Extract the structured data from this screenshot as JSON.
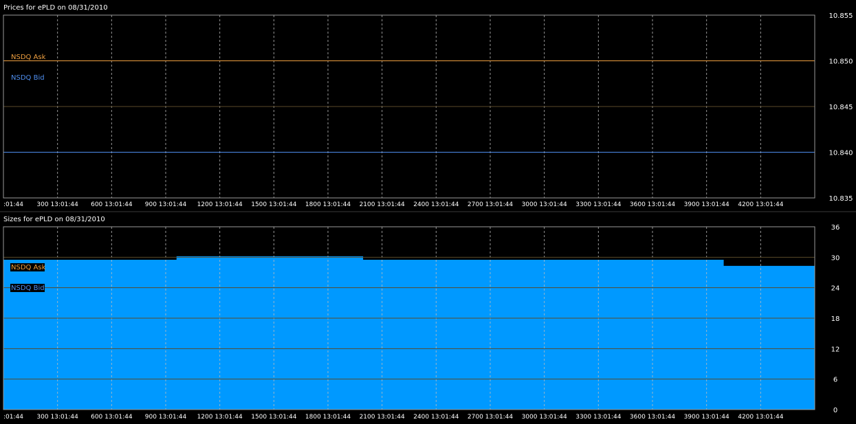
{
  "colors": {
    "background": "#000000",
    "grid": "#bdbdbd",
    "frame": "#9a9a9a",
    "text": "#ffffff",
    "ask": "#f0a040",
    "bid": "#4f8ff0",
    "size_fill": "#0099ff",
    "size_fill_bid": "#33aaff"
  },
  "chart_data": [
    {
      "type": "line",
      "title": "Prices for  ePLD  on  08/31/2010",
      "x_tick_labels": [
        ":01:44",
        "300 13:01:44",
        "600 13:01:44",
        "900 13:01:44",
        "1200 13:01:44",
        "1500 13:01:44",
        "1800 13:01:44",
        "2100 13:01:44",
        "2400 13:01:44",
        "2700 13:01:44",
        "3000 13:01:44",
        "3300 13:01:44",
        "3600 13:01:44",
        "3900 13:01:44",
        "4200 13:01:44"
      ],
      "x_tick_values": [
        0,
        300,
        600,
        900,
        1200,
        1500,
        1800,
        2100,
        2400,
        2700,
        3000,
        3300,
        3600,
        3900,
        4200
      ],
      "xlim": [
        0,
        4500
      ],
      "ylim": [
        10.835,
        10.855
      ],
      "y_tick_values": [
        10.835,
        10.84,
        10.845,
        10.85,
        10.855
      ],
      "y_tick_labels": [
        "10.835",
        "10.840",
        "10.845",
        "10.850",
        "10.855"
      ],
      "grid": true,
      "legend_position": "top-left",
      "series": [
        {
          "name": "NSDQ Ask",
          "color": "#f0a040",
          "x": [
            0,
            4500
          ],
          "y": [
            10.85,
            10.85
          ]
        },
        {
          "name": "NSDQ Bid",
          "color": "#4f8ff0",
          "x": [
            0,
            4500
          ],
          "y": [
            10.84,
            10.84
          ]
        }
      ]
    },
    {
      "type": "area",
      "title": "Sizes for  ePLD  on  08/31/2010",
      "x_tick_labels": [
        ":01:44",
        "300 13:01:44",
        "600 13:01:44",
        "900 13:01:44",
        "1200 13:01:44",
        "1500 13:01:44",
        "1800 13:01:44",
        "2100 13:01:44",
        "2400 13:01:44",
        "2700 13:01:44",
        "3000 13:01:44",
        "3300 13:01:44",
        "3600 13:01:44",
        "3900 13:01:44",
        "4200 13:01:44"
      ],
      "x_tick_values": [
        0,
        300,
        600,
        900,
        1200,
        1500,
        1800,
        2100,
        2400,
        2700,
        3000,
        3300,
        3600,
        3900,
        4200
      ],
      "xlim": [
        0,
        4500
      ],
      "ylim": [
        0,
        36
      ],
      "y_tick_values": [
        0,
        6,
        12,
        18,
        24,
        30,
        36
      ],
      "y_tick_labels": [
        "0",
        "6",
        "12",
        "18",
        "24",
        "30",
        "36"
      ],
      "grid": true,
      "legend_position": "top-left",
      "series": [
        {
          "name": "NSDQ Ask",
          "color": "#0099ff",
          "step_x": [
            0,
            960,
            1995,
            3995,
            4500
          ],
          "step_y": [
            29.5,
            30.2,
            29.5,
            28.3
          ]
        },
        {
          "name": "NSDQ Bid",
          "color": "#33aaff",
          "step_x": [
            0,
            4500
          ],
          "step_y": [
            0
          ]
        }
      ]
    }
  ]
}
